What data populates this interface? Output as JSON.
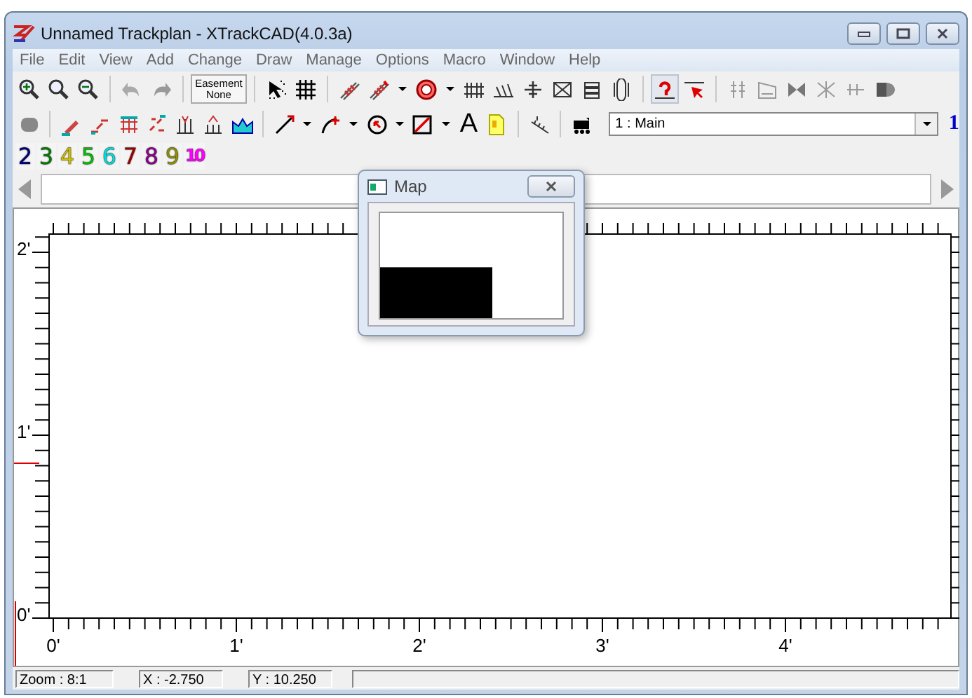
{
  "window": {
    "title": "Unnamed Trackplan - XTrackCAD(4.0.3a)"
  },
  "menu": [
    "File",
    "Edit",
    "View",
    "Add",
    "Change",
    "Draw",
    "Manage",
    "Options",
    "Macro",
    "Window",
    "Help"
  ],
  "toolbar": {
    "easement_label": "Easement",
    "easement_value": "None",
    "text_tool": "A",
    "layer_select": "1 : Main",
    "current_layer": "1"
  },
  "layers": [
    {
      "label": "2",
      "color": "#000080"
    },
    {
      "label": "3",
      "color": "#008000"
    },
    {
      "label": "4",
      "color": "#d0c000"
    },
    {
      "label": "5",
      "color": "#00c000"
    },
    {
      "label": "6",
      "color": "#00e0e0"
    },
    {
      "label": "7",
      "color": "#a00000"
    },
    {
      "label": "8",
      "color": "#900090"
    },
    {
      "label": "9",
      "color": "#909000"
    },
    {
      "label": "10",
      "color": "#ff00ff"
    }
  ],
  "canvas": {
    "y_labels": [
      "2'",
      "1'",
      "0'"
    ],
    "x_labels": [
      "0'",
      "1'",
      "2'",
      "3'",
      "4'"
    ]
  },
  "map": {
    "title": "Map"
  },
  "status_bar": {
    "zoom": "Zoom : 8:1",
    "x": "X : -2.750",
    "y": "Y : 10.250"
  }
}
